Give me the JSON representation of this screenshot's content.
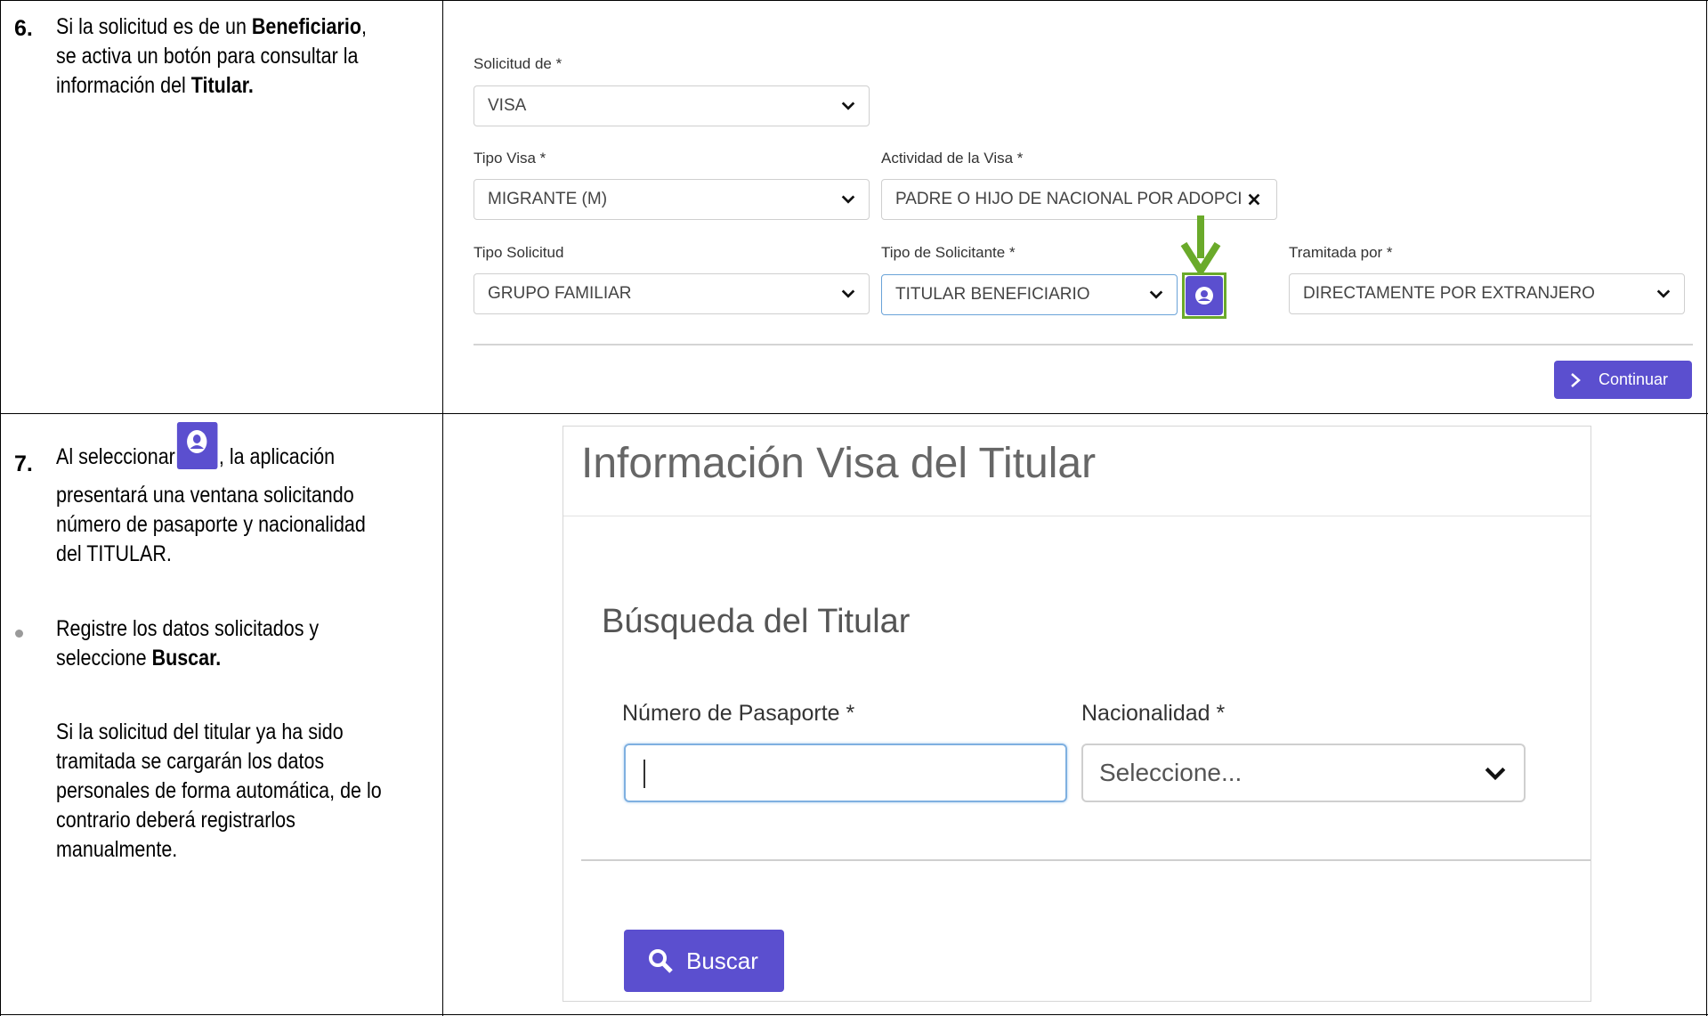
{
  "step6": {
    "number": "6.",
    "line1_pre": "Si la solicitud es de un ",
    "line1_bold": "Beneficiario",
    "line1_post": ",",
    "line2": "se activa un botón para consultar la",
    "line3_pre": "información del ",
    "line3_bold": "Titular."
  },
  "step7": {
    "number": "7.",
    "line1_pre": "Al seleccionar",
    "line1_post": ", la aplicación",
    "line2": "presentará una ventana solicitando",
    "line3": "número de pasaporte y nacionalidad",
    "line4": "del TITULAR.",
    "bullet_line1": "Registre los datos solicitados y",
    "bullet_line2_pre": "seleccione ",
    "bullet_line2_bold": "Buscar.",
    "para_lines": [
      "Si la solicitud del titular ya ha sido",
      "tramitada se cargarán los datos",
      "personales de forma automática, de lo",
      "contrario deberá registrarlos",
      "manualmente."
    ]
  },
  "form": {
    "solicitud_label": "Solicitud de *",
    "solicitud_value": "VISA",
    "tipo_visa_label": "Tipo Visa *",
    "tipo_visa_value": "MIGRANTE (M)",
    "actividad_label": "Actividad de la Visa *",
    "actividad_value": "PADRE O HIJO DE NACIONAL POR ADOPCI",
    "tipo_solicitud_label": "Tipo Solicitud",
    "tipo_solicitud_value": "GRUPO FAMILIAR",
    "tipo_solicitante_label": "Tipo de Solicitante *",
    "tipo_solicitante_value": "TITULAR BENEFICIARIO",
    "tramitada_label": "Tramitada por *",
    "tramitada_value": "DIRECTAMENTE POR EXTRANJERO",
    "continuar_label": "Continuar",
    "accent_color": "#5b4fcf",
    "highlight_color": "#6aaa2a"
  },
  "dialog": {
    "title": "Información Visa del Titular",
    "subtitle": "Búsqueda del Titular",
    "pasaporte_label": "Número de Pasaporte *",
    "pasaporte_value": "",
    "nacionalidad_label": "Nacionalidad *",
    "nacionalidad_value": "Seleccione...",
    "buscar_label": "Buscar"
  }
}
